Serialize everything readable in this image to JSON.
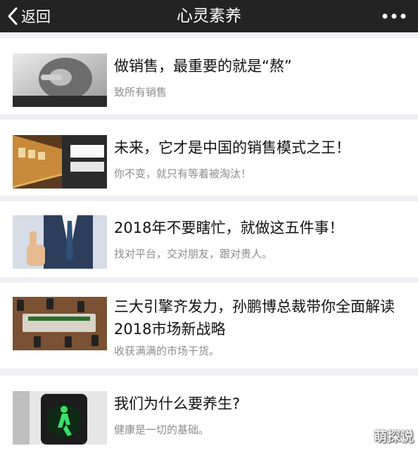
{
  "navbar": {
    "back_label": "返回",
    "title": "心灵素养"
  },
  "articles": [
    {
      "title": "做销售，最重要的就是“熬”",
      "subtitle": "致所有销售",
      "thumb_icon": "pointing-man-photo"
    },
    {
      "title": "未来，它才是中国的销售模式之王！",
      "subtitle": "你不变，就只有等着被淘汰！",
      "thumb_icon": "subway-station-photo"
    },
    {
      "title": "2018年不要瞎忙，就做这五件事！",
      "subtitle": "找对平台，交对朋友，跟对贵人。",
      "thumb_icon": "thumbs-up-businessman-photo"
    },
    {
      "title": "三大引擎齐发力，孙鹏博总裁带你全面解读2018市场新战略",
      "subtitle": "收获满满的市场干货。",
      "thumb_icon": "meeting-table-phones-photo"
    },
    {
      "title": "我们为什么要养生?",
      "subtitle": "健康是一切的基础。",
      "thumb_icon": "green-pedestrian-light-photo"
    }
  ],
  "watermark": "萌探说"
}
